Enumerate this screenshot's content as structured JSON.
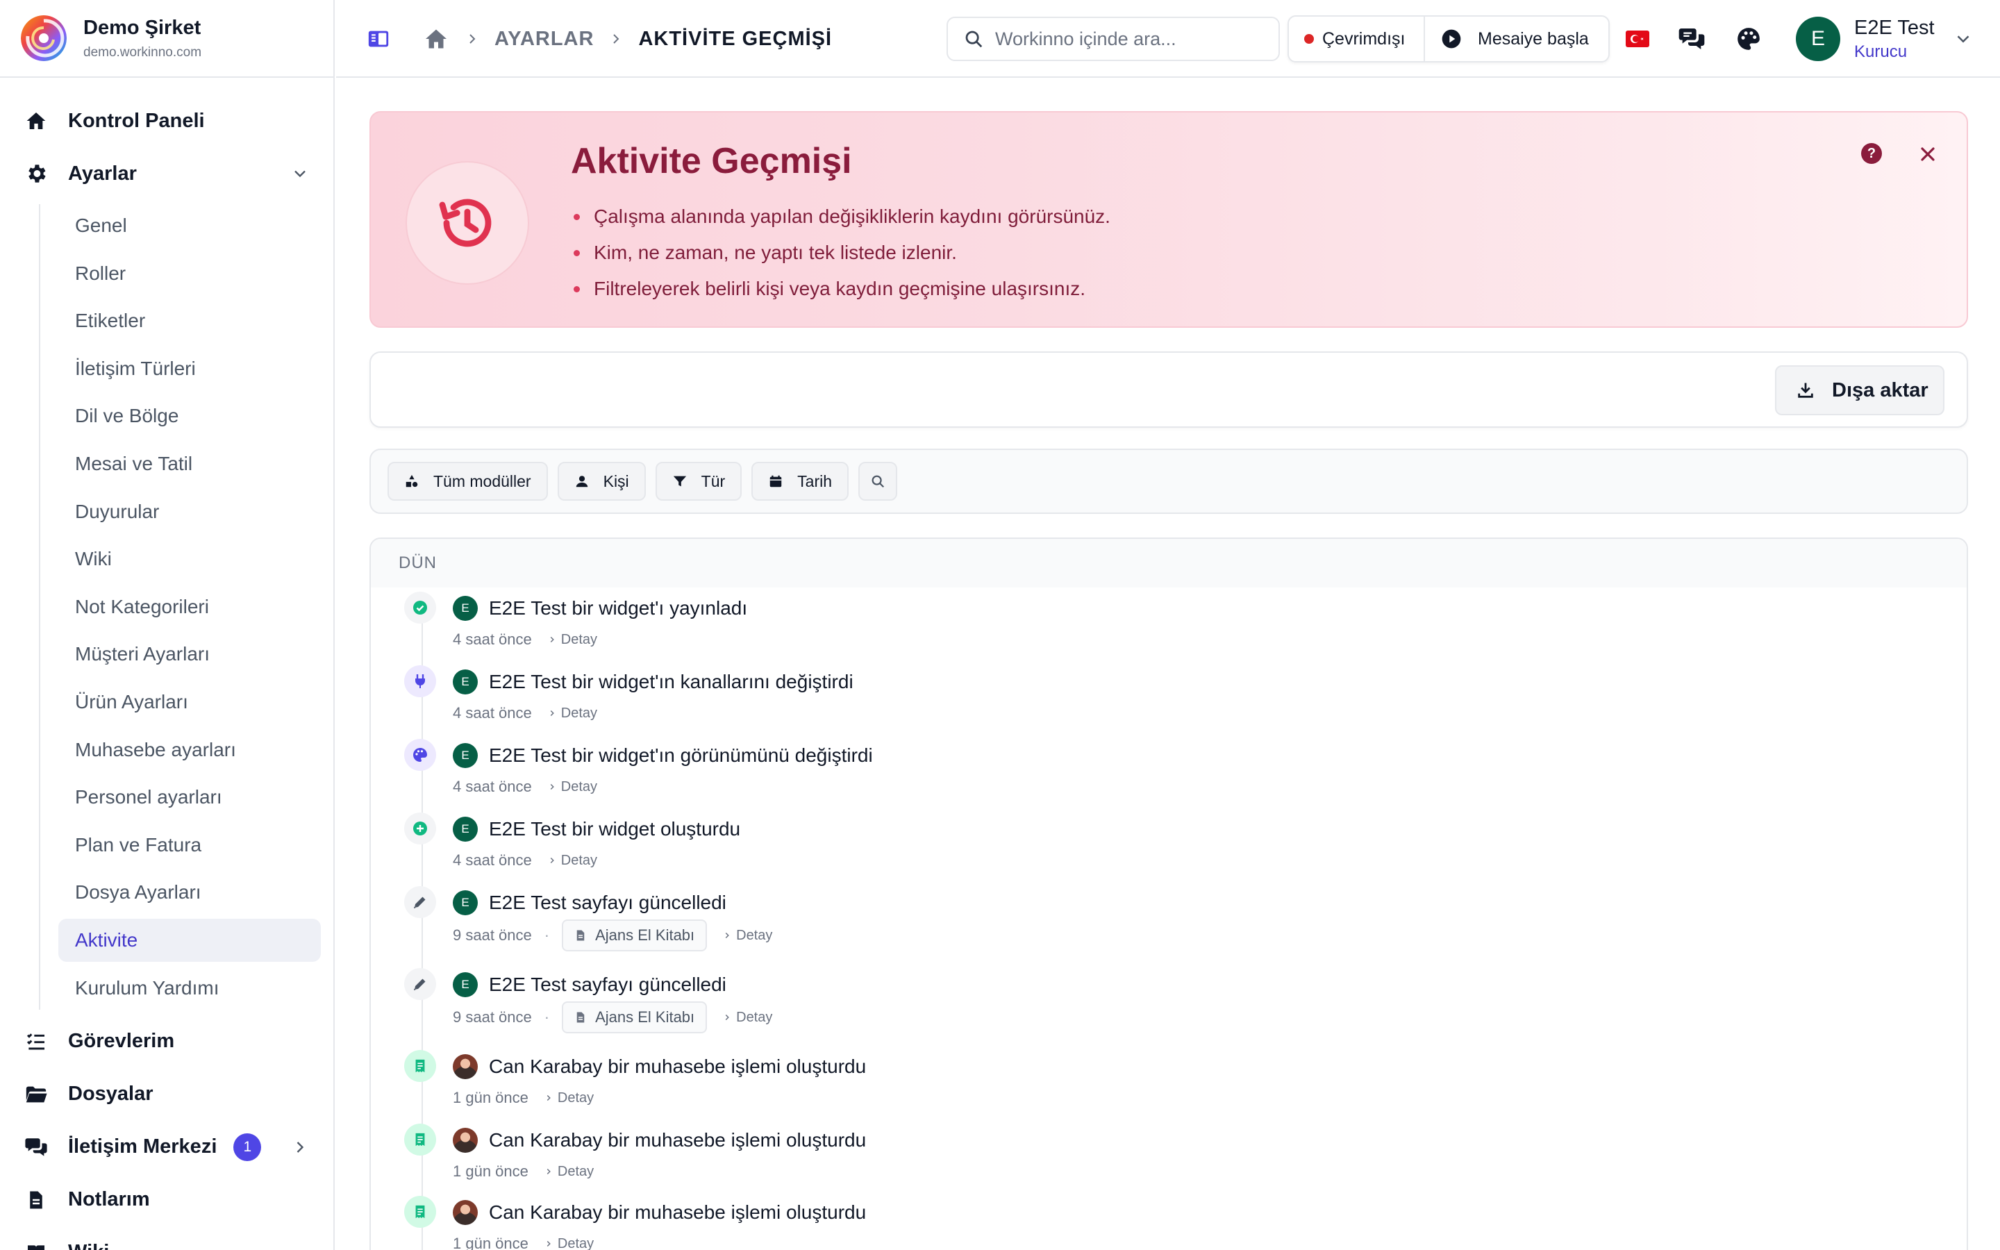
{
  "brand": {
    "name": "Demo Şirket",
    "domain": "demo.workinno.com"
  },
  "sidebar": {
    "dashboard": "Kontrol Paneli",
    "settings": "Ayarlar",
    "settings_items": [
      "Genel",
      "Roller",
      "Etiketler",
      "İletişim Türleri",
      "Dil ve Bölge",
      "Mesai ve Tatil",
      "Duyurular",
      "Wiki",
      "Not Kategorileri",
      "Müşteri Ayarları",
      "Ürün Ayarları",
      "Muhasebe ayarları",
      "Personel ayarları",
      "Plan ve Fatura",
      "Dosya Ayarları",
      "Aktivite",
      "Kurulum Yardımı"
    ],
    "active_item": "Aktivite",
    "tasks": "Görevlerim",
    "files": "Dosyalar",
    "comm_center": "İletişim Merkezi",
    "comm_badge": "1",
    "notes": "Notlarım",
    "wiki": "Wiki"
  },
  "topbar": {
    "breadcrumb": [
      "AYARLAR",
      "AKTİVİTE GEÇMİŞİ"
    ],
    "search_placeholder": "Workinno içinde ara...",
    "status_offline": "Çevrimdışı",
    "start_shift": "Mesaiye başla",
    "user_name": "E2E Test",
    "user_role": "Kurucu",
    "user_initial": "E",
    "icons": [
      "sidebar-toggle-icon",
      "home-icon",
      "turkey-flag-icon",
      "chat-icon",
      "palette-icon"
    ]
  },
  "hero": {
    "title": "Aktivite Geçmişi",
    "bullets": [
      "Çalışma alanında yapılan değişikliklerin kaydını görürsünüz.",
      "Kim, ne zaman, ne yaptı tek listede izlenir.",
      "Filtreleyerek belirli kişi veya kaydın geçmişine ulaşırsınız."
    ],
    "help": "?"
  },
  "toolbar": {
    "export_label": "Dışa aktar"
  },
  "filters": {
    "modules": "Tüm modüller",
    "person": "Kişi",
    "type": "Tür",
    "date": "Tarih"
  },
  "timeline": {
    "group_label": "DÜN",
    "detail_label": "Detay",
    "entries": [
      {
        "icon": "check-icon",
        "actor_initial": "E",
        "text": "E2E Test bir widget'ı yayınladı",
        "time": "4 saat önce"
      },
      {
        "icon": "plug-icon",
        "actor_initial": "E",
        "text": "E2E Test bir widget'ın kanallarını değiştirdi",
        "time": "4 saat önce"
      },
      {
        "icon": "palette-icon",
        "actor_initial": "E",
        "text": "E2E Test bir widget'ın görünümünü değiştirdi",
        "time": "4 saat önce"
      },
      {
        "icon": "plus-icon",
        "actor_initial": "E",
        "text": "E2E Test bir widget oluşturdu",
        "time": "4 saat önce"
      },
      {
        "icon": "pencil-icon",
        "actor_initial": "E",
        "text": "E2E Test sayfayı güncelledi",
        "time": "9 saat önce",
        "ref": "Ajans El Kitabı"
      },
      {
        "icon": "pencil-icon",
        "actor_initial": "E",
        "text": "E2E Test sayfayı güncelledi",
        "time": "9 saat önce",
        "ref": "Ajans El Kitabı"
      },
      {
        "icon": "receipt-icon",
        "actor_photo": true,
        "text": "Can Karabay bir muhasebe işlemi oluşturdu",
        "time": "1 gün önce"
      },
      {
        "icon": "receipt-icon",
        "actor_photo": true,
        "text": "Can Karabay bir muhasebe işlemi oluşturdu",
        "time": "1 gün önce"
      },
      {
        "icon": "receipt-icon",
        "actor_photo": true,
        "text": "Can Karabay bir muhasebe işlemi oluşturdu",
        "time": "1 gün önce"
      }
    ]
  },
  "colors": {
    "accent": "#4338ca",
    "hero_title": "#8a1c3c",
    "success": "#10b981",
    "avatar": "#065f46"
  }
}
